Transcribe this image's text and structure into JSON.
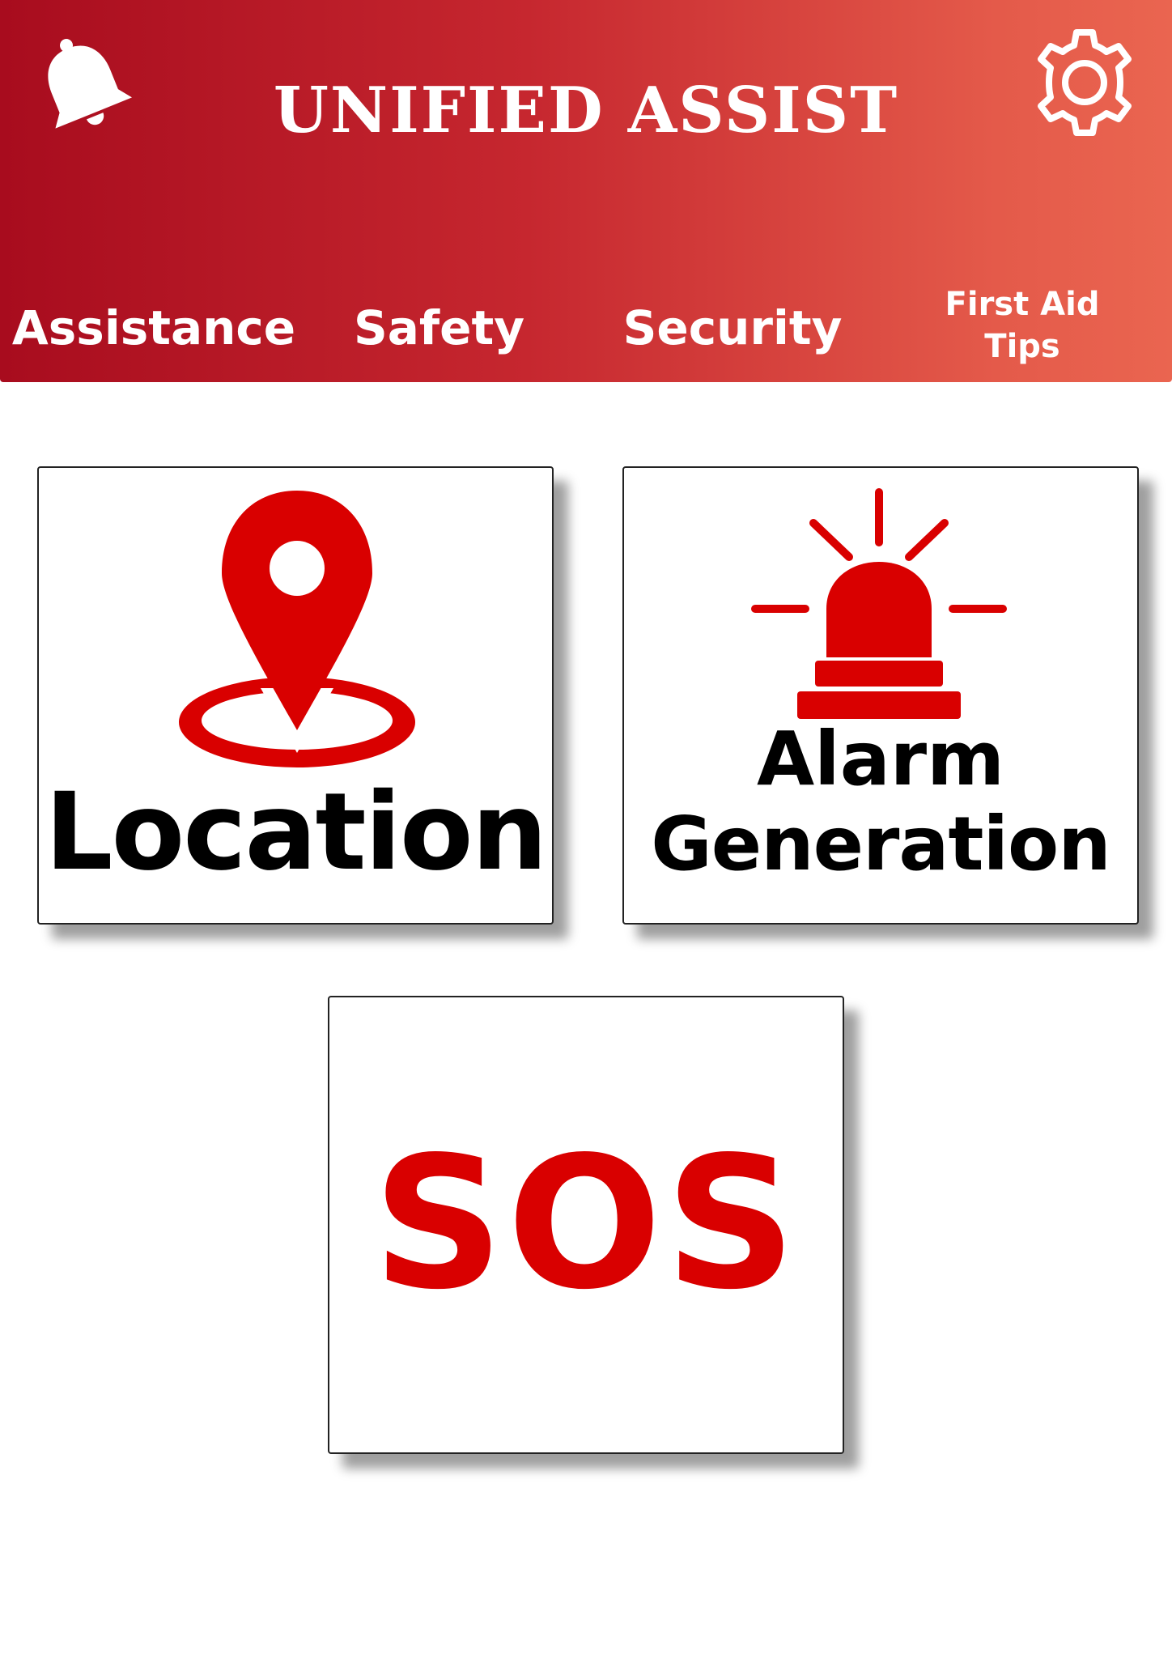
{
  "header": {
    "title": "UNIFIED ASSIST",
    "left_icon": "bell-icon",
    "right_icon": "gear-icon",
    "gradient_start": "#a80c1e",
    "gradient_end": "#ea6550"
  },
  "tabs": [
    {
      "label": "Assistance"
    },
    {
      "label": "Safety"
    },
    {
      "label": "Security"
    },
    {
      "label": "First Aid Tips"
    }
  ],
  "tiles": {
    "location": {
      "label": "Location",
      "icon": "location-pin-icon"
    },
    "alarm": {
      "label_line1": "Alarm",
      "label_line2": "Generation",
      "icon": "siren-icon"
    },
    "sos": {
      "label": "SOS"
    }
  },
  "colors": {
    "accent_red": "#d90000",
    "text_dark": "#000000",
    "background": "#ffffff"
  }
}
